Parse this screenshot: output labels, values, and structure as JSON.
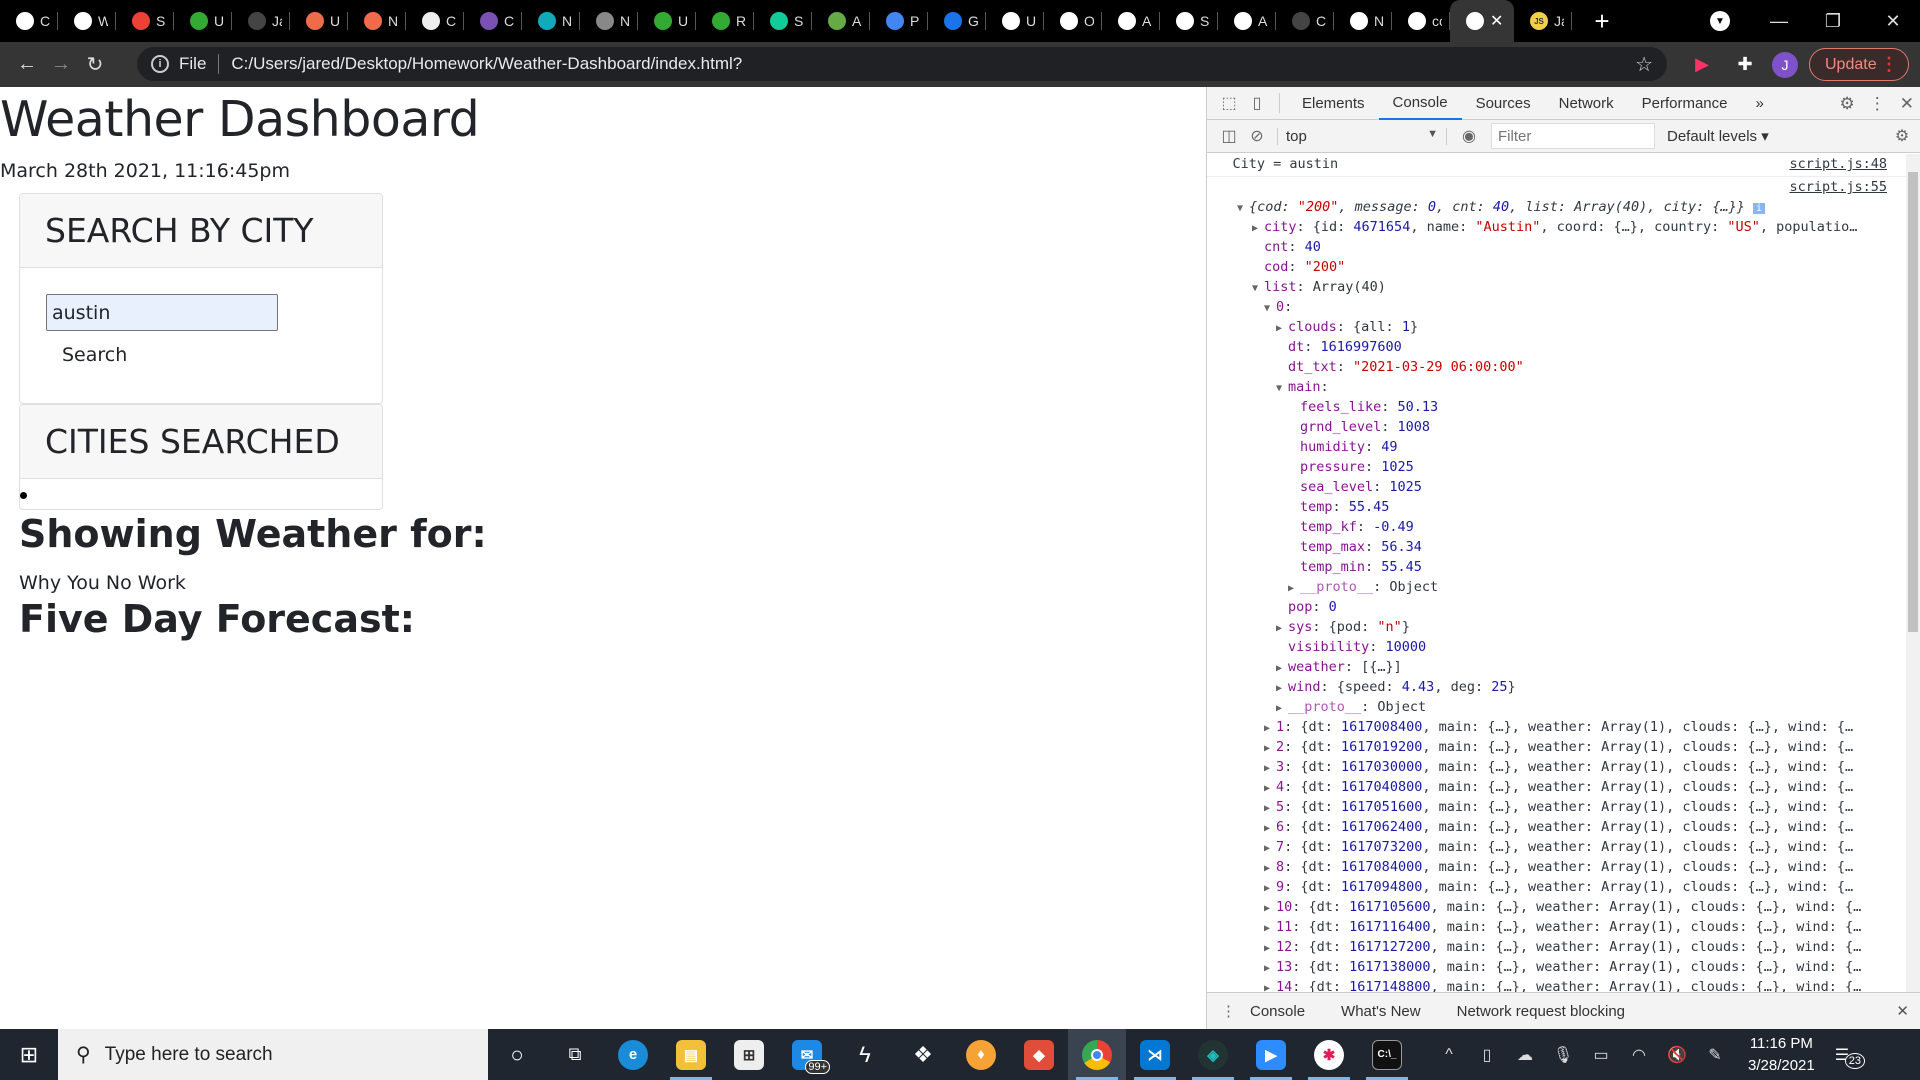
{
  "browser": {
    "tabs": [
      {
        "icon": "globe-icon",
        "label": "C",
        "color": "#fff"
      },
      {
        "icon": "bird-icon",
        "label": "W",
        "color": "#fff"
      },
      {
        "icon": "gmail-icon",
        "label": "S",
        "color": "#ea4335"
      },
      {
        "icon": "compass-icon",
        "label": "U",
        "color": "#3a3"
      },
      {
        "icon": "github-icon",
        "label": "Ja",
        "color": "#444"
      },
      {
        "icon": "helmet-icon",
        "label": "U",
        "color": "#f06b4a"
      },
      {
        "icon": "helmet-icon",
        "label": "N",
        "color": "#f06b4a"
      },
      {
        "icon": "notepad-icon",
        "label": "C",
        "color": "#eee"
      },
      {
        "icon": "bootstrap-icon",
        "label": "C",
        "color": "#7952b3"
      },
      {
        "icon": "clock-icon",
        "label": "N",
        "color": "#1ab"
      },
      {
        "icon": "hex-icon",
        "label": "N",
        "color": "#888"
      },
      {
        "icon": "compass-icon",
        "label": "U",
        "color": "#3a3"
      },
      {
        "icon": "compass-icon",
        "label": "R",
        "color": "#3a3"
      },
      {
        "icon": "leaf-icon",
        "label": "S",
        "color": "#1c9"
      },
      {
        "icon": "badge-icon",
        "label": "A",
        "color": "#6a4"
      },
      {
        "icon": "docs-icon",
        "label": "P",
        "color": "#4285f4"
      },
      {
        "icon": "cloud-icon",
        "label": "G",
        "color": "#1a73e8"
      },
      {
        "icon": "bird-icon",
        "label": "U",
        "color": "#fff"
      },
      {
        "icon": "code-icon",
        "label": "O",
        "color": "#fff"
      },
      {
        "icon": "code-icon",
        "label": "A",
        "color": "#fff"
      },
      {
        "icon": "code-icon",
        "label": "S",
        "color": "#fff"
      },
      {
        "icon": "code-icon",
        "label": "A",
        "color": "#fff"
      },
      {
        "icon": "github-icon",
        "label": "C",
        "color": "#444"
      },
      {
        "icon": "globe-icon",
        "label": "N",
        "color": "#fff"
      },
      {
        "icon": "google-icon",
        "label": "co",
        "color": "#fff"
      }
    ],
    "active_tab": {
      "icon": "globe-icon",
      "close": "✕"
    },
    "after_tab": {
      "icon": "js-icon",
      "label": "Ja",
      "badge": "JS"
    },
    "new_tab": "+",
    "address": {
      "scheme": "File",
      "url": "C:/Users/jared/Desktop/Homework/Weather-Dashboard/index.html?"
    },
    "avatar": "J",
    "update_label": "Update"
  },
  "page": {
    "title": "Weather Dashboard",
    "datetime": "March 28th 2021, 11:16:45pm",
    "search_card": {
      "header": "SEARCH BY CITY",
      "input_value": "austin",
      "button": "Search"
    },
    "cities_card": {
      "header": "CITIES SEARCHED"
    },
    "showing_label": "Showing Weather for:",
    "status_text": "Why You No Work",
    "forecast_label": "Five Day Forecast:"
  },
  "devtools": {
    "tabs": [
      "Elements",
      "Console",
      "Sources",
      "Network",
      "Performance"
    ],
    "active_tab": "Console",
    "context": "top",
    "filter_placeholder": "Filter",
    "levels": "Default levels ▾",
    "drawer_tabs": [
      "Console",
      "What's New",
      "Network request blocking"
    ],
    "log1": {
      "text": "City = austin",
      "source": "script.js:48"
    },
    "log2_source": "script.js:55",
    "obj_summary": {
      "cod": "\"200\"",
      "message": "0",
      "cnt": "40",
      "list": "Array(40)",
      "city": "{…}"
    },
    "city": {
      "id": "4671654",
      "name": "\"Austin\"",
      "coord": "{…}",
      "country": "\"US\"",
      "rest": "populatio…"
    },
    "cnt": "40",
    "cod": "\"200\"",
    "list_label": "Array(40)",
    "item0": {
      "clouds": "{all: 1}",
      "dt": "1616997600",
      "dt_txt": "\"2021-03-29 06:00:00\"",
      "main": [
        {
          "k": "feels_like",
          "v": "50.13"
        },
        {
          "k": "grnd_level",
          "v": "1008"
        },
        {
          "k": "humidity",
          "v": "49"
        },
        {
          "k": "pressure",
          "v": "1025"
        },
        {
          "k": "sea_level",
          "v": "1025"
        },
        {
          "k": "temp",
          "v": "55.45"
        },
        {
          "k": "temp_kf",
          "v": "-0.49"
        },
        {
          "k": "temp_max",
          "v": "56.34"
        },
        {
          "k": "temp_min",
          "v": "55.45"
        }
      ],
      "pop": "0",
      "sys_pod": "\"n\"",
      "visibility": "10000",
      "weather": "[{…}]",
      "wind_speed": "4.43",
      "wind_deg": "25"
    },
    "list_items": [
      {
        "i": "1",
        "dt": "1617008400"
      },
      {
        "i": "2",
        "dt": "1617019200"
      },
      {
        "i": "3",
        "dt": "1617030000"
      },
      {
        "i": "4",
        "dt": "1617040800"
      },
      {
        "i": "5",
        "dt": "1617051600"
      },
      {
        "i": "6",
        "dt": "1617062400"
      },
      {
        "i": "7",
        "dt": "1617073200"
      },
      {
        "i": "8",
        "dt": "1617084000"
      },
      {
        "i": "9",
        "dt": "1617094800"
      },
      {
        "i": "10",
        "dt": "1617105600"
      },
      {
        "i": "11",
        "dt": "1617116400"
      },
      {
        "i": "12",
        "dt": "1617127200"
      },
      {
        "i": "13",
        "dt": "1617138000"
      },
      {
        "i": "14",
        "dt": "1617148800"
      }
    ]
  },
  "taskbar": {
    "search_placeholder": "Type here to search",
    "mail_badge": "99+",
    "time": "11:16 PM",
    "date": "3/28/2021",
    "notifications": "23"
  }
}
